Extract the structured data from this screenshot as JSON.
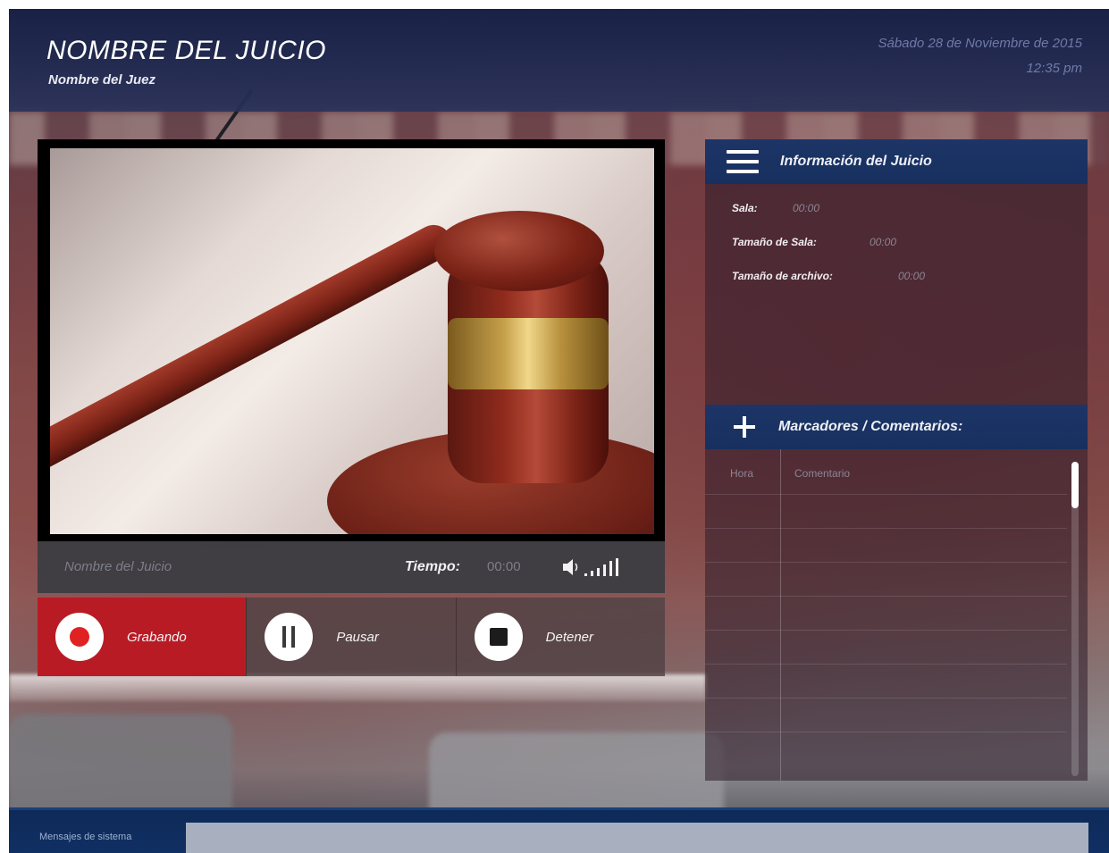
{
  "header": {
    "title": "NOMBRE DEL JUICIO",
    "subtitle": "Nombre del Juez",
    "date": "Sábado 28 de Noviembre de 2015",
    "time": "12:35 pm"
  },
  "player": {
    "name": "Nombre del Juicio",
    "time_label": "Tiempo:",
    "time_value": "00:00",
    "volume_icon": "volume-icon"
  },
  "controls": {
    "record_label": "Grabando",
    "pause_label": "Pausar",
    "stop_label": "Detener"
  },
  "info_panel": {
    "title": "Información del Juicio",
    "rows": [
      {
        "label": "Sala:",
        "value": "00:00"
      },
      {
        "label": "Tamaño de Sala:",
        "value": "00:00"
      },
      {
        "label": "Tamaño de archivo:",
        "value": "00:00"
      }
    ]
  },
  "markers_panel": {
    "title": "Marcadores / Comentarios:",
    "columns": [
      "Hora",
      "Comentario"
    ]
  },
  "footer": {
    "label": "Mensajes de sistema"
  },
  "colors": {
    "header_bg": "#1c2a5e",
    "panel_header": "#1c3566",
    "record_red": "#b91b25",
    "footer_bg": "#0e2a58"
  }
}
